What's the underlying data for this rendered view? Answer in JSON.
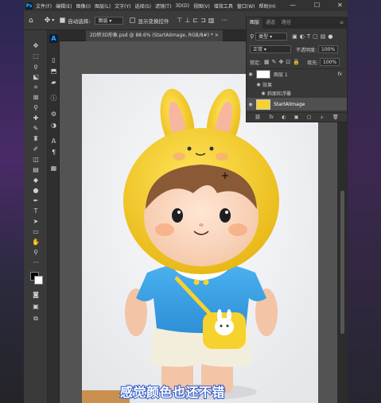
{
  "app": {
    "logo": "Ps"
  },
  "menubar": {
    "items": [
      "文件(F)",
      "编辑(E)",
      "图像(I)",
      "图层(L)",
      "文字(Y)",
      "选择(S)",
      "滤镜(T)",
      "3D(D)",
      "视图(V)",
      "增效工具",
      "窗口(W)",
      "帮助(H)"
    ],
    "min": "—",
    "max": "☐",
    "close": "✕"
  },
  "options": {
    "auto_select_label": "自动选择:",
    "auto_select_target": "图层",
    "show_transform_label": "显示变换控件"
  },
  "document": {
    "tab_label": "2D转3D形象.psd @ 88.6% (StartAIImage, RGB/8#) *",
    "close": "×"
  },
  "layers_panel": {
    "tabs": [
      "图层",
      "通道",
      "路径"
    ],
    "filter": "类型",
    "blend_mode": "正常",
    "opacity_label": "不透明度:",
    "opacity_value": "100%",
    "lock_label": "锁定:",
    "fill_label": "填充:",
    "fill_value": "100%",
    "layers": [
      {
        "name": "图层 1",
        "fx": "fx"
      },
      {
        "name": "效果"
      },
      {
        "name": "斜面和浮雕"
      },
      {
        "name": "StartAIImage"
      }
    ],
    "bottom_icons": [
      "fx",
      "◐",
      "▣",
      "▢",
      "＋",
      "🗑"
    ]
  },
  "subtitle": "感觉颜色也还不错",
  "colors": {
    "accent": "#31a8ff",
    "subtitle_stroke": "#2b58c9",
    "hood": "#f6d22e",
    "shirt": "#3aa1e6"
  }
}
